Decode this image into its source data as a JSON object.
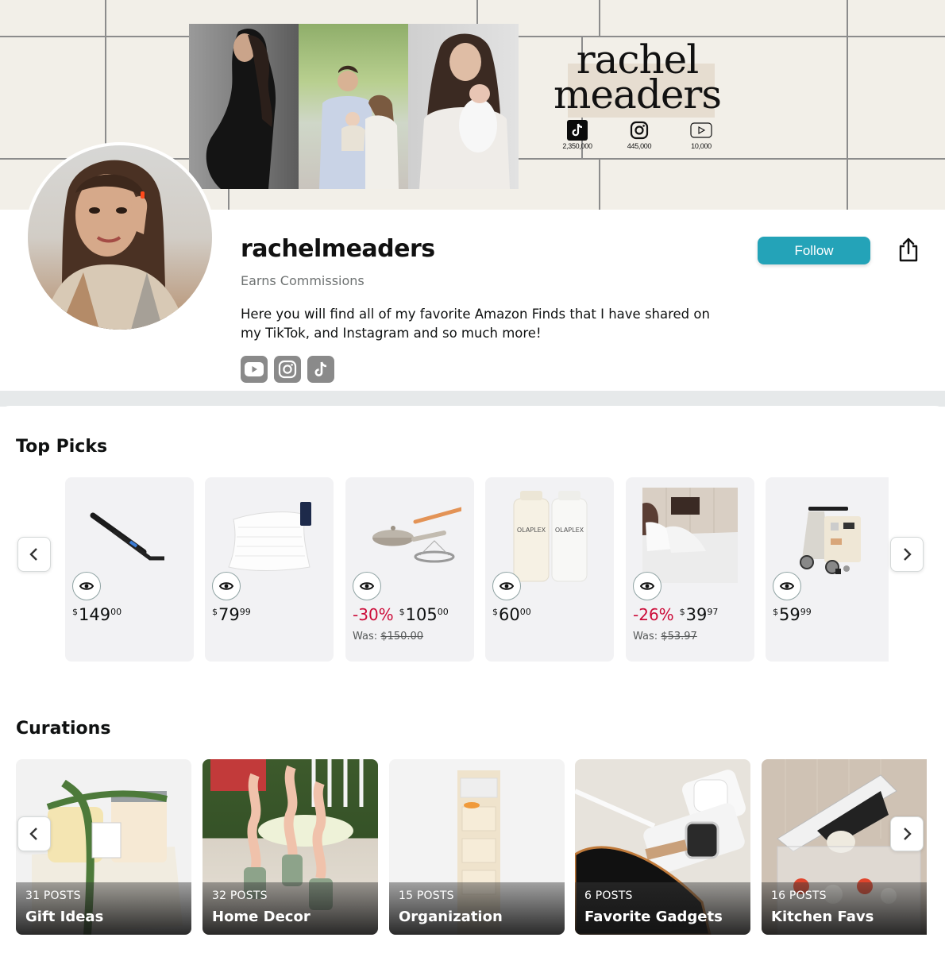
{
  "banner": {
    "brand_line1": "rachel",
    "brand_line2": "meaders",
    "stats": [
      {
        "icon": "tiktok-icon",
        "value": "2,350,000"
      },
      {
        "icon": "instagram-icon",
        "value": "445,000"
      },
      {
        "icon": "youtube-icon",
        "value": "10,000"
      }
    ]
  },
  "profile": {
    "username": "rachelmeaders",
    "subtitle": "Earns Commissions",
    "bio": "Here you will find all of my favorite Amazon Finds that I have shared on my TikTok, and Instagram and so much more!",
    "follow_label": "Follow",
    "share_icon": "share-icon",
    "socials": [
      "youtube-icon",
      "instagram-icon",
      "tiktok-icon"
    ]
  },
  "colors": {
    "accent": "#24a3b8",
    "discount": "#cc0c39",
    "banner_bg": "#eeeae2"
  },
  "top_picks": {
    "title": "Top Picks",
    "products": [
      {
        "name": "Curling Iron",
        "currency": "$",
        "whole": "149",
        "fraction": "00",
        "discount": null,
        "was": null
      },
      {
        "name": "Bed Pillows",
        "currency": "$",
        "whole": "79",
        "fraction": "99",
        "discount": null,
        "was": null
      },
      {
        "name": "Always Pan",
        "currency": "$",
        "whole": "105",
        "fraction": "00",
        "discount": "-30%",
        "was_label": "Was:",
        "was": "$150.00"
      },
      {
        "name": "Olaplex No.4 & No.5",
        "currency": "$",
        "whole": "60",
        "fraction": "00",
        "discount": null,
        "was": null
      },
      {
        "name": "Bed Sheets",
        "currency": "$",
        "whole": "39",
        "fraction": "97",
        "discount": "-26%",
        "was_label": "Was:",
        "was": "$53.97"
      },
      {
        "name": "Baby Activity Walker",
        "currency": "$",
        "whole": "59",
        "fraction": "99",
        "discount": null,
        "was": null
      }
    ]
  },
  "curations": {
    "title": "Curations",
    "items": [
      {
        "posts": "31 POSTS",
        "name": "Gift Ideas"
      },
      {
        "posts": "32 POSTS",
        "name": "Home Decor"
      },
      {
        "posts": "15 POSTS",
        "name": "Organization"
      },
      {
        "posts": "6 POSTS",
        "name": "Favorite Gadgets"
      },
      {
        "posts": "16 POSTS",
        "name": "Kitchen Favs"
      }
    ]
  }
}
